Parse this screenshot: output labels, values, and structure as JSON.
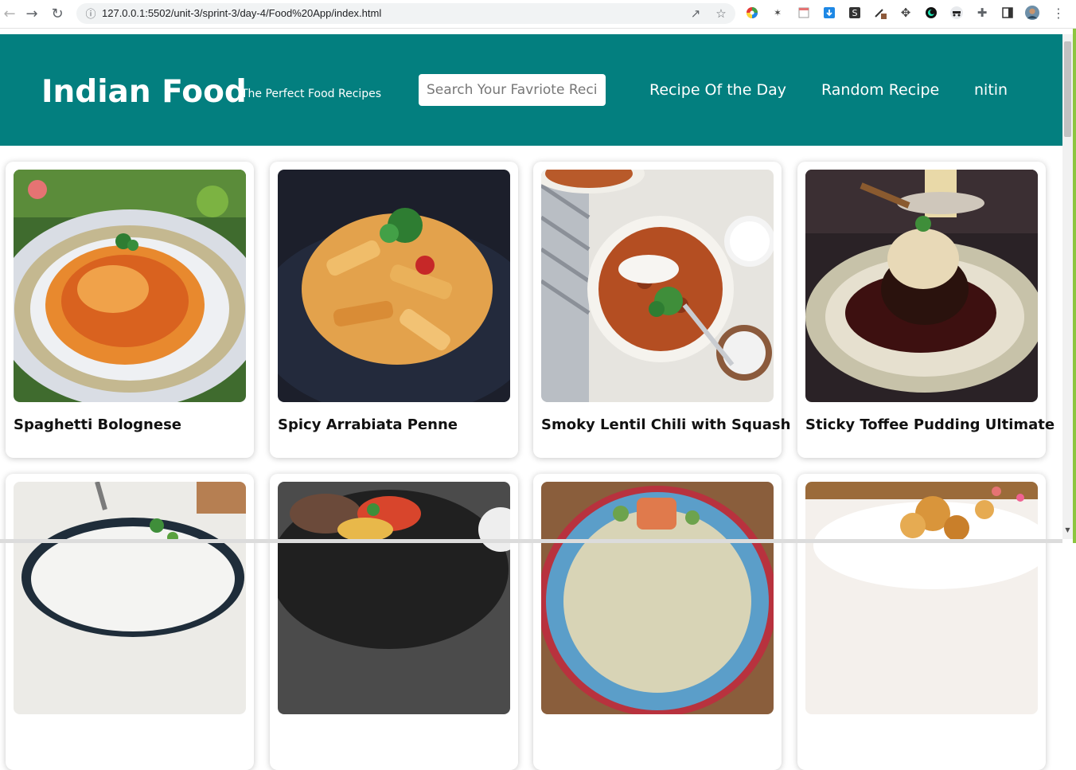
{
  "browser": {
    "url": "127.0.0.1:5502/unit-3/sprint-3/day-4/Food%20App/index.html",
    "icons": [
      "back-arrow-icon",
      "forward-arrow-icon",
      "reload-icon",
      "info-icon",
      "share-icon",
      "star-icon",
      "extensions-icon",
      "side-panel-icon",
      "profile-avatar",
      "menu-icon"
    ]
  },
  "header": {
    "brand": "Indian Food",
    "tagline": "The Perfect Food Recipes",
    "search_placeholder": "Search Your Favriote Reciepe",
    "nav": [
      "Recipe Of the Day",
      "Random Recipe",
      "nitin"
    ],
    "bg_color": "#037f7f"
  },
  "cards": [
    {
      "title": "Spaghetti Bolognese",
      "image": "spaghetti-photo"
    },
    {
      "title": "Spicy Arrabiata Penne",
      "image": "penne-photo"
    },
    {
      "title": "Smoky Lentil Chili with Squash",
      "image": "lentil-chili-photo"
    },
    {
      "title": "Sticky Toffee Pudding Ultimate",
      "image": "toffee-pudding-photo"
    },
    {
      "title": "",
      "image": "salad-plate-photo"
    },
    {
      "title": "",
      "image": "roasted-veg-photo"
    },
    {
      "title": "",
      "image": "salmon-rice-photo"
    },
    {
      "title": "",
      "image": "pastry-dessert-photo"
    }
  ]
}
